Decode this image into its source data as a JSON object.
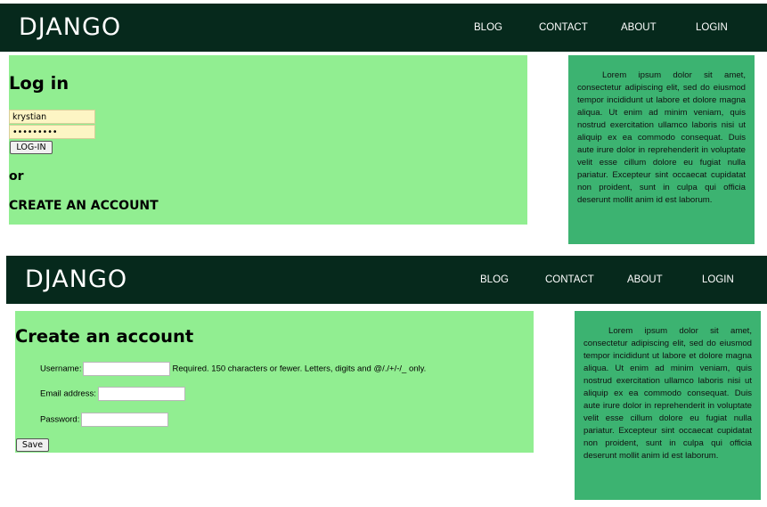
{
  "brand": "DJANGO",
  "nav": {
    "blog": "BLOG",
    "contact": "CONTACT",
    "about": "ABOUT",
    "login": "LOGIN"
  },
  "sidebar_text": "Lorem ipsum dolor sit amet, consectetur adipiscing elit, sed do eiusmod tempor incididunt ut labore et dolore magna aliqua. Ut enim ad minim veniam, quis nostrud exercitation ullamco laboris nisi ut aliquip ex ea commodo consequat. Duis aute irure dolor in reprehenderit in voluptate velit esse cillum dolore eu fugiat nulla pariatur. Excepteur sint occaecat cupidatat non proident, sunt in culpa qui officia deserunt mollit anim id est laborum.",
  "login": {
    "title": "Log in",
    "username_value": "krystian",
    "password_value": "•••••••••",
    "button_label": "LOG-IN",
    "or_text": "or",
    "create_link": "CREATE AN ACCOUNT"
  },
  "create": {
    "title": "Create an account",
    "username_label": "Username:",
    "username_help": "Required. 150 characters or fewer. Letters, digits and @/./+/-/_ only.",
    "email_label": "Email address:",
    "password_label": "Password:",
    "save_label": "Save"
  },
  "colors": {
    "navbar": "#06291c",
    "main_panel": "#91ee91",
    "side_panel": "#3cb371",
    "login_input_bg": "#fdf5c4"
  }
}
